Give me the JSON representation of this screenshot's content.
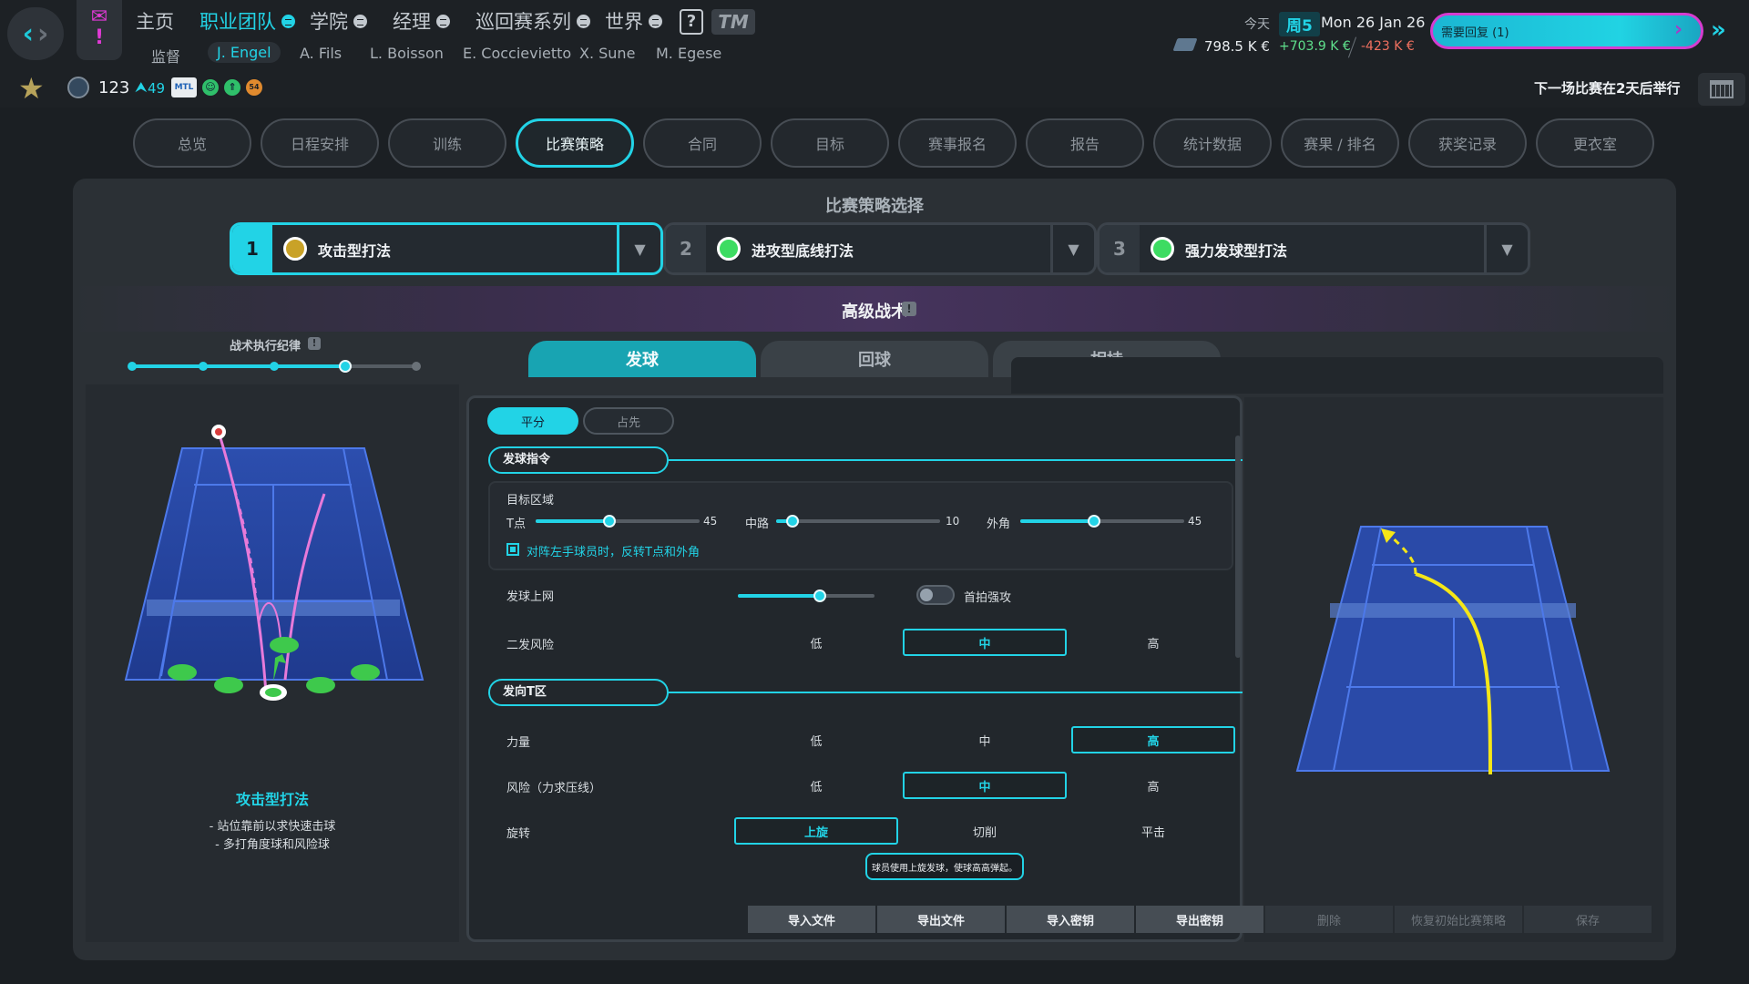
{
  "top_menu": {
    "home": "主页",
    "team": "职业团队",
    "academy": "学院",
    "manager": "经理",
    "tour_series": "巡回赛系列",
    "world": "世界",
    "help": "?",
    "logo": "TM"
  },
  "team_members": [
    "监督",
    "J. Engel",
    "A. Fils",
    "L. Boisson",
    "E. Coccievietto",
    "X. Sune",
    "M. Egese"
  ],
  "date_info": {
    "today_label": "今天",
    "weekday": "周5",
    "date": "Mon 26 Jan 26",
    "balance": "798.5 K €",
    "income": "+703.9 K €",
    "expense": "-423 K €"
  },
  "action_required": "需要回复 (1)",
  "player_status": {
    "rank": "123",
    "rank_change": "49",
    "team_logo": "MTL",
    "form_value": "54"
  },
  "next_match": "下一场比赛在2天后举行",
  "tabs": [
    "总览",
    "日程安排",
    "训练",
    "比赛策略",
    "合同",
    "目标",
    "赛事报名",
    "报告",
    "统计数据",
    "赛果 / 排名",
    "获奖记录",
    "更衣室"
  ],
  "strategy": {
    "section_title": "比赛策略选择",
    "slots": [
      {
        "num": "1",
        "name": "攻击型打法",
        "color": "#c9a227"
      },
      {
        "num": "2",
        "name": "进攻型底线打法",
        "color": "#3ddc62"
      },
      {
        "num": "3",
        "name": "强力发球型打法",
        "color": "#3ddc62"
      }
    ]
  },
  "advanced": {
    "title": "高级战术",
    "discipline_label": "战术执行纪律",
    "discipline_level": 4,
    "discipline_max": 5,
    "subtabs": [
      "发球",
      "回球",
      "相持"
    ]
  },
  "left_panel": {
    "style_name": "攻击型打法",
    "desc": [
      "- 站位靠前以求快速击球",
      "- 多打角度球和风险球"
    ]
  },
  "serve": {
    "pills": [
      "平分",
      "占先"
    ],
    "instructions_title": "发球指令",
    "target_title": "目标区域",
    "zones": [
      {
        "label": "T点",
        "value": 45
      },
      {
        "label": "中路",
        "value": 10
      },
      {
        "label": "外角",
        "value": 45
      }
    ],
    "mirror_label": "对阵左手球员时，反转T点和外角",
    "net_label": "发球上网",
    "net_value": 0.6,
    "first_strike_label": "首拍强攻",
    "second_risk_label": "二发风险",
    "second_risk_options": [
      "低",
      "中",
      "高"
    ],
    "second_risk_selected": 1,
    "t_section_title": "发向T区",
    "power_label": "力量",
    "power_options": [
      "低",
      "中",
      "高"
    ],
    "power_selected": 2,
    "risk_label": "风险（力求压线）",
    "risk_options": [
      "低",
      "中",
      "高"
    ],
    "risk_selected": 1,
    "spin_label": "旋转",
    "spin_options": [
      "上旋",
      "切削",
      "平击"
    ],
    "spin_selected": 0,
    "tooltip": "球员使用上旋发球，使球高高弹起。"
  },
  "bottom_buttons": {
    "active": [
      "导入文件",
      "导出文件",
      "导入密钥",
      "导出密钥"
    ],
    "disabled": [
      "删除",
      "恢复初始比赛策略",
      "保存"
    ]
  },
  "colors": {
    "accent": "#22d3e6",
    "court": "#2a4aa8",
    "trajectory_pink": "#e77ad9",
    "trajectory_yellow": "#f5e617",
    "player_dot": "#3ec94c"
  }
}
